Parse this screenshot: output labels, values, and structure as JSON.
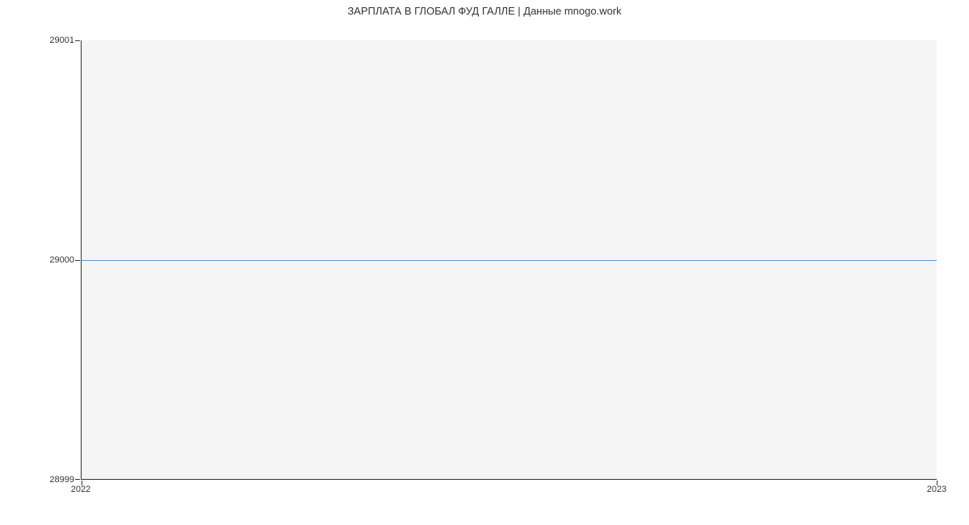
{
  "chart_data": {
    "type": "line",
    "title": "ЗАРПЛАТА В ГЛОБАЛ ФУД ГАЛЛЕ | Данные mnogo.work",
    "xlabel": "",
    "ylabel": "",
    "x": [
      2022,
      2023
    ],
    "values": [
      29000,
      29000
    ],
    "ylim": [
      28999,
      29001
    ],
    "xlim": [
      2022,
      2023
    ],
    "y_ticks": [
      28999,
      29000,
      29001
    ],
    "x_ticks": [
      2022,
      2023
    ],
    "line_color": "#5b9bd5"
  }
}
